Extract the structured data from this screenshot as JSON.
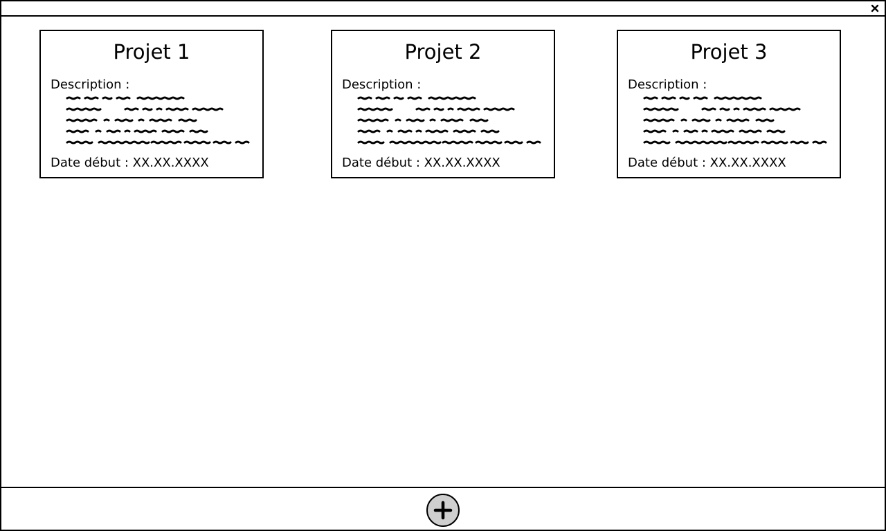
{
  "window": {
    "close_icon": "close-icon"
  },
  "projects": [
    {
      "title": "Projet 1",
      "description_label": "Description :",
      "date_label": "Date début : XX.XX.XXXX"
    },
    {
      "title": "Projet 2",
      "description_label": "Description :",
      "date_label": "Date début : XX.XX.XXXX"
    },
    {
      "title": "Projet 3",
      "description_label": "Description :",
      "date_label": "Date début : XX.XX.XXXX"
    }
  ],
  "footer": {
    "add_icon": "plus-icon",
    "add_button_color": "#cfcfcf"
  }
}
